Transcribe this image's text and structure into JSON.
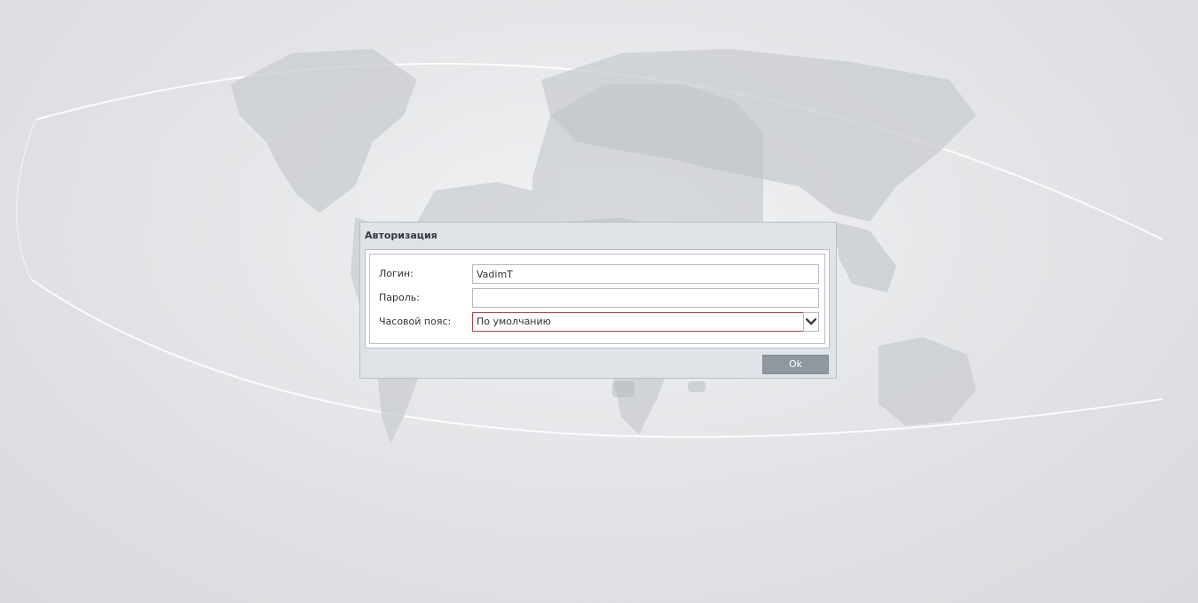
{
  "dialog": {
    "title": "Авторизация",
    "login_label": "Логин:",
    "login_value": "VadimT",
    "password_label": "Пароль:",
    "password_value": "",
    "timezone_label": "Часовой пояс:",
    "timezone_value": "По умолчанию",
    "ok_label": "Ok"
  },
  "icons": {
    "dropdown": "chevron-down-icon"
  },
  "colors": {
    "background": "#e2e4e7",
    "dialog_bg": "#dfe3e8",
    "button_bg": "#8f979f",
    "invalid_border": "#b0454a"
  }
}
